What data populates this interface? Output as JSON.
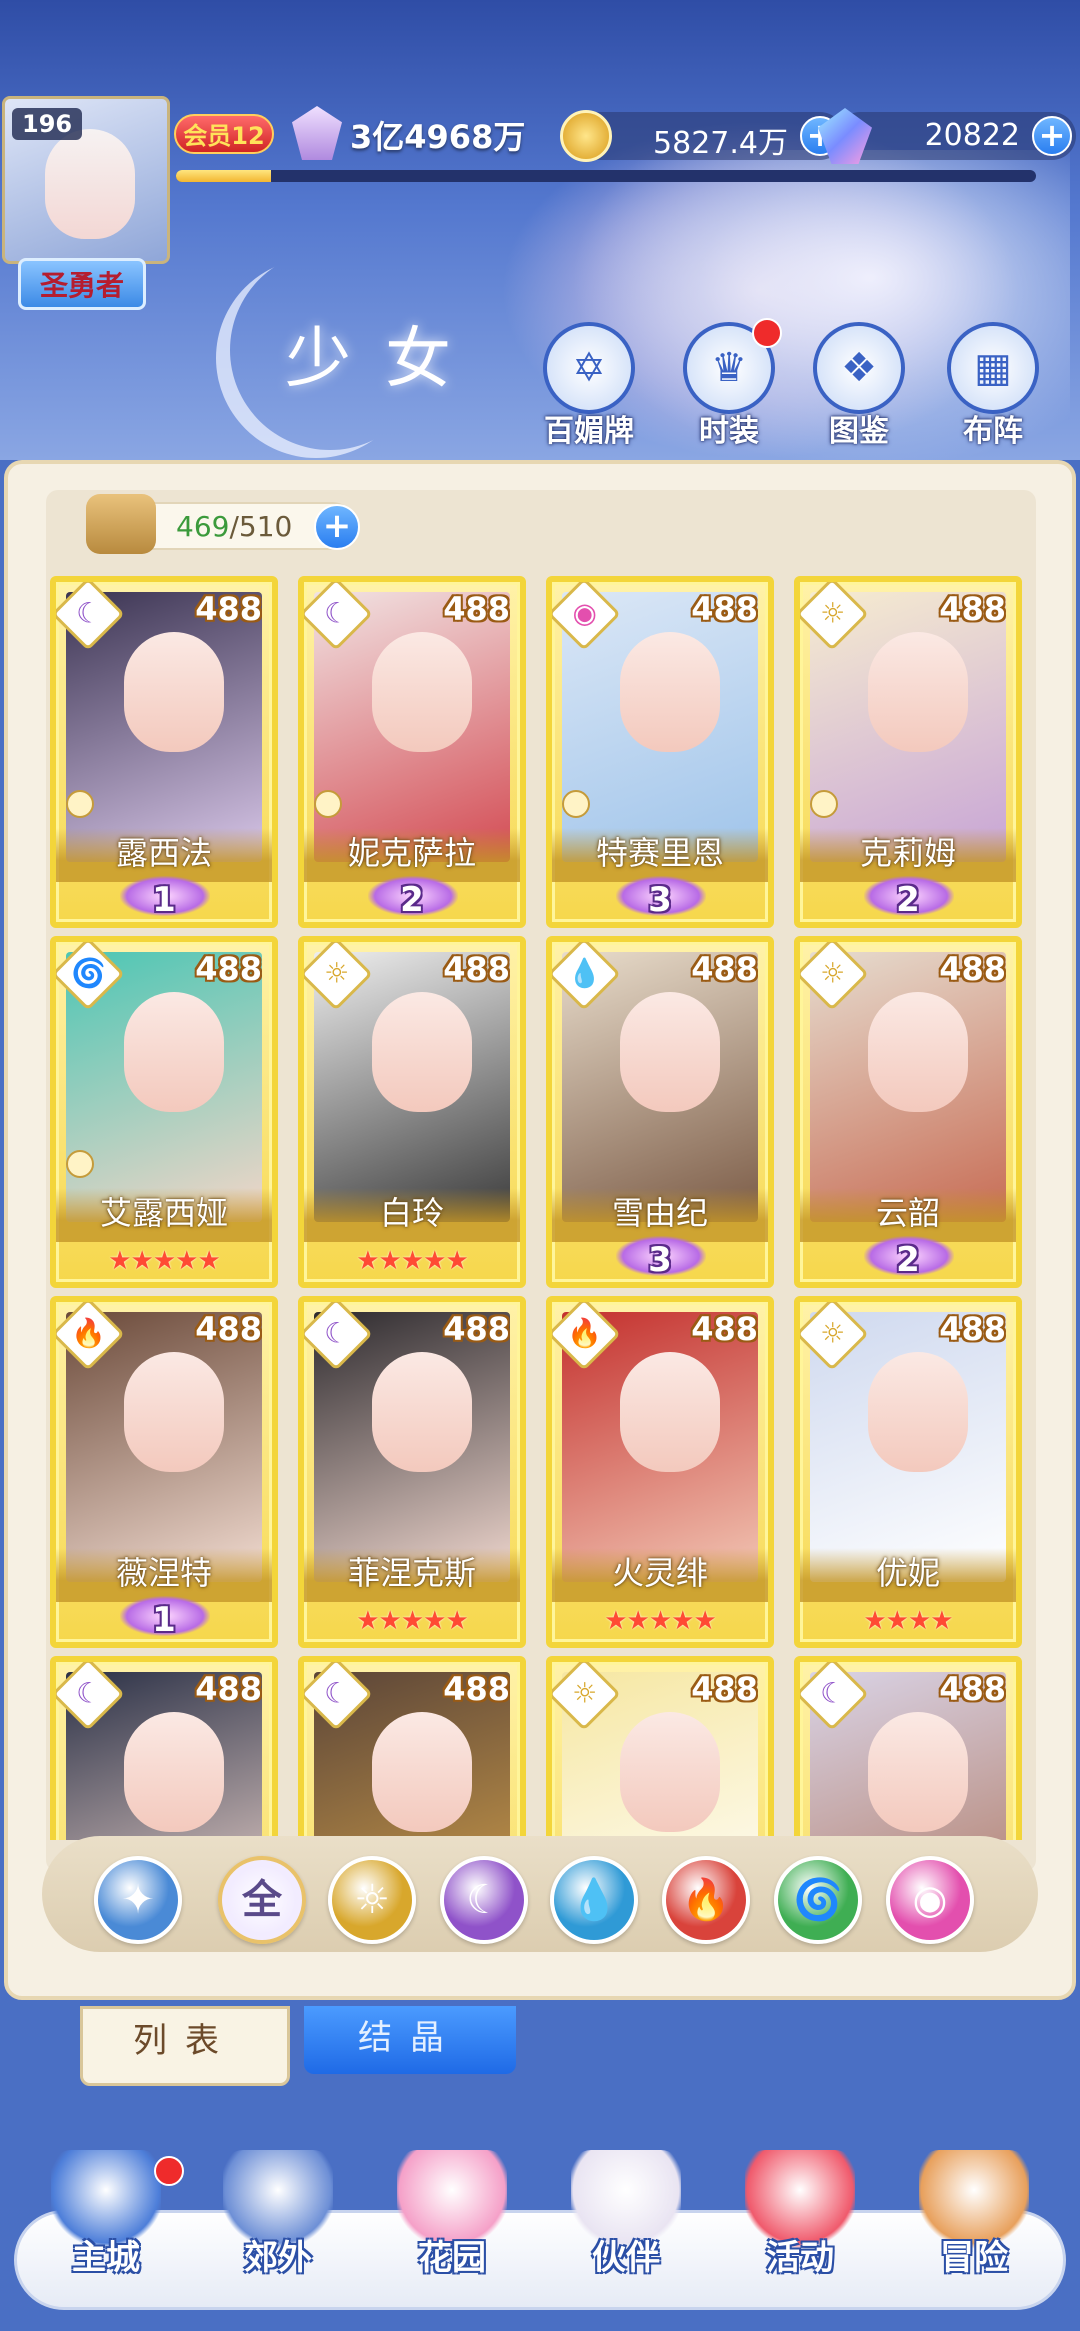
{
  "header": {
    "player_level": "196",
    "title_badge": "圣勇者",
    "vip_label": "会员12",
    "power": "3亿4968万",
    "exp_progress": 0.11,
    "gold": "5827.4万",
    "gems": "20822",
    "page_title": "少女"
  },
  "banner_nav": [
    {
      "label": "百媚牌",
      "icon": "card-hexagram-icon"
    },
    {
      "label": "时装",
      "icon": "costume-icon",
      "has_notification": true
    },
    {
      "label": "图鉴",
      "icon": "book-icon"
    },
    {
      "label": "布阵",
      "icon": "formation-grid-icon"
    }
  ],
  "collection": {
    "current": "469",
    "max": "/510"
  },
  "cards": [
    {
      "name": "露西法",
      "level": "488",
      "element": "moon",
      "rank_type": "wing",
      "rank": "1"
    },
    {
      "name": "妮克萨拉",
      "level": "488",
      "element": "moon",
      "rank_type": "wing",
      "rank": "2"
    },
    {
      "name": "特赛里恩",
      "level": "488",
      "element": "chaos",
      "rank_type": "wing",
      "rank": "3"
    },
    {
      "name": "克莉姆",
      "level": "488",
      "element": "sun",
      "rank_type": "wing",
      "rank": "2"
    },
    {
      "name": "艾露西娅",
      "level": "488",
      "element": "wind",
      "rank_type": "stars",
      "rank": "★★★★★"
    },
    {
      "name": "白玲",
      "level": "488",
      "element": "sun",
      "rank_type": "stars",
      "rank": "★★★★★"
    },
    {
      "name": "雪由纪",
      "level": "488",
      "element": "water",
      "rank_type": "wing",
      "rank": "3"
    },
    {
      "name": "云韶",
      "level": "488",
      "element": "sun",
      "rank_type": "wing",
      "rank": "2"
    },
    {
      "name": "薇涅特",
      "level": "488",
      "element": "fire",
      "rank_type": "wing",
      "rank": "1"
    },
    {
      "name": "菲涅克斯",
      "level": "488",
      "element": "moon",
      "rank_type": "stars",
      "rank": "★★★★★"
    },
    {
      "name": "火灵绯",
      "level": "488",
      "element": "fire",
      "rank_type": "stars",
      "rank": "★★★★★"
    },
    {
      "name": "优妮",
      "level": "488",
      "element": "sun",
      "rank_type": "stars",
      "rank": "★★★★"
    },
    {
      "name": "",
      "level": "488",
      "element": "moon",
      "rank_type": "none",
      "rank": ""
    },
    {
      "name": "",
      "level": "488",
      "element": "moon",
      "rank_type": "none",
      "rank": ""
    },
    {
      "name": "",
      "level": "488",
      "element": "sun",
      "rank_type": "none",
      "rank": ""
    },
    {
      "name": "",
      "level": "488",
      "element": "moon",
      "rank_type": "none",
      "rank": ""
    }
  ],
  "element_filters": [
    {
      "id": "sort",
      "glyph": "✦",
      "color": "#4a8ad6"
    },
    {
      "id": "all",
      "glyph": "全",
      "color": "#7c6fb5"
    },
    {
      "id": "sun",
      "glyph": "☼",
      "color": "#d8a72c"
    },
    {
      "id": "moon",
      "glyph": "☾",
      "color": "#8f52c9"
    },
    {
      "id": "water",
      "glyph": "💧",
      "color": "#2f9ad6"
    },
    {
      "id": "fire",
      "glyph": "🔥",
      "color": "#d9433b"
    },
    {
      "id": "wind",
      "glyph": "🌀",
      "color": "#3fae53"
    },
    {
      "id": "chaos",
      "glyph": "◉",
      "color": "#e34fae"
    }
  ],
  "tabs": {
    "list": "列表",
    "crystal": "结晶"
  },
  "bottom_nav": [
    {
      "label": "主城",
      "icon": "castle-icon",
      "has_notification": true
    },
    {
      "label": "郊外",
      "icon": "hexagram-portal-icon"
    },
    {
      "label": "花园",
      "icon": "heart-icon"
    },
    {
      "label": "伙伴",
      "icon": "companion-portrait-icon",
      "active": true
    },
    {
      "label": "活动",
      "icon": "gift-box-icon"
    },
    {
      "label": "冒险",
      "icon": "compass-icon"
    }
  ],
  "colors": {
    "element_sun": "#d8a72c",
    "element_moon": "#8f52c9",
    "element_water": "#2f9ad6",
    "element_fire": "#d9433b",
    "element_wind": "#3fae53",
    "element_chaos": "#e34fae"
  }
}
